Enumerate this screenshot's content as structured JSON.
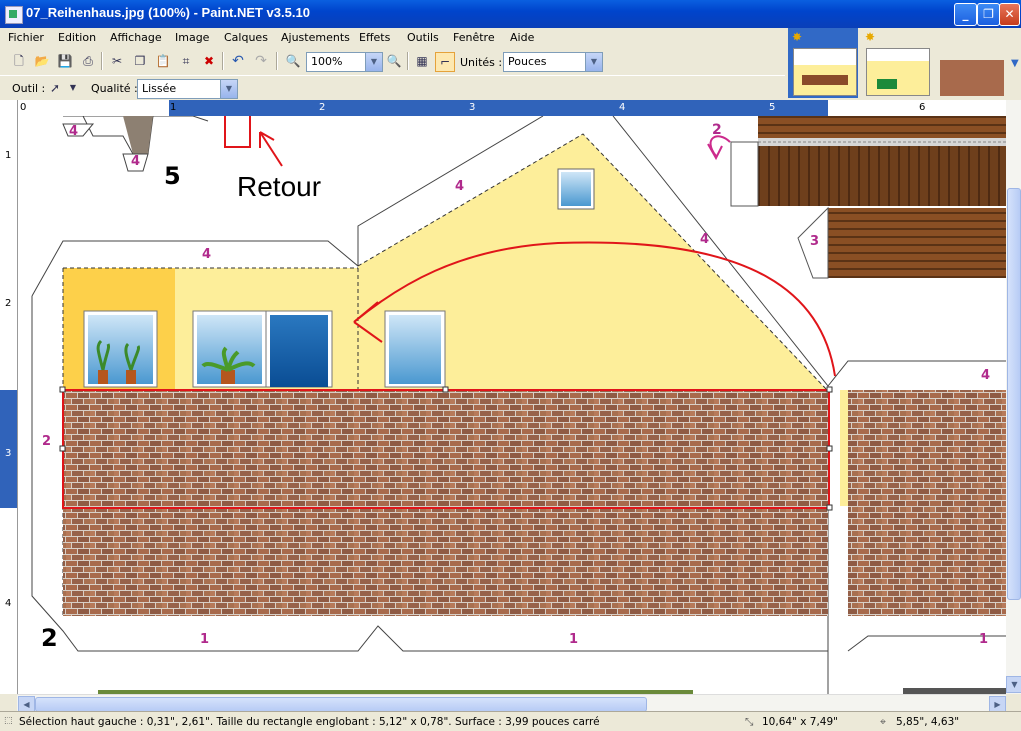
{
  "window": {
    "title": "07_Reihenhaus.jpg (100%) - Paint.NET v3.5.10"
  },
  "menu": [
    "Fichier",
    "Edition",
    "Affichage",
    "Image",
    "Calques",
    "Ajustements",
    "Effets",
    "Outils",
    "Fenêtre",
    "Aide"
  ],
  "toolbar": {
    "zoom_value": "100%",
    "units_label": "Unités :",
    "units_value": "Pouces"
  },
  "options": {
    "tool_label": "Outil :",
    "quality_label": "Qualité :",
    "quality_value": "Lissée"
  },
  "ruler": {
    "h_labels": [
      "0",
      "1",
      "2",
      "3",
      "4",
      "5",
      "6"
    ],
    "v_labels": [
      "1",
      "2",
      "3",
      "4"
    ]
  },
  "canvas_labels": {
    "num_4_a": "4",
    "num_4_b": "4",
    "num_5": "5",
    "num_2_arrow": "2",
    "num_4_roof_left": "4",
    "num_4_roof_right": "4",
    "num_4_wall": "4",
    "num_3": "3",
    "num_4_side": "4",
    "num_2_left": "2",
    "num_2_bold": "2",
    "num_1_a": "1",
    "num_1_b": "1",
    "num_1_c": "1",
    "annotation": "Retour"
  },
  "status": {
    "selection": "Sélection haut gauche : 0,31\", 2,61\". Taille du rectangle englobant : 5,12\" x 0,78\". Surface : 3,99 pouces carré",
    "image_size": "10,64\" x 7,49\"",
    "cursor": "5,85\", 4,63\""
  },
  "colors": {
    "titlebar": "#0a5fe0",
    "ruler": "#3063ba",
    "wall": "#fdee9a",
    "brick": "#a86a4c",
    "annotation": "#e0151a"
  }
}
